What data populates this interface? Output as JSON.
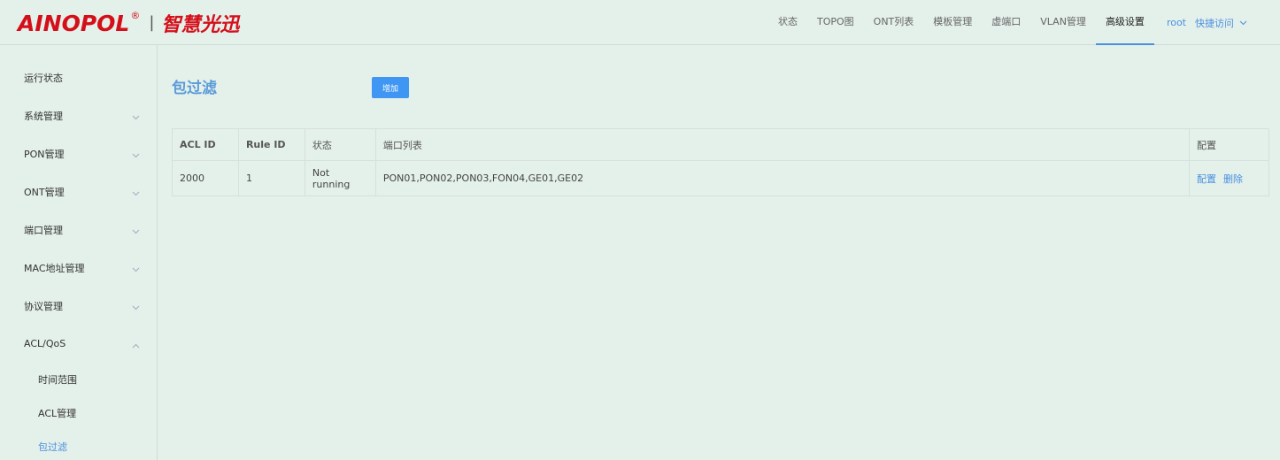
{
  "header": {
    "brand": "AINOPOL",
    "reg_mark": "®",
    "separator": "|",
    "brand_cn": "智慧光迅",
    "nav": [
      "状态",
      "TOPO图",
      "ONT列表",
      "模板管理",
      "虚端口",
      "VLAN管理",
      "高级设置"
    ],
    "active_nav": "高级设置",
    "user": "root",
    "quick_access": "快捷访问"
  },
  "sidebar": {
    "items": [
      "运行状态",
      "系统管理",
      "PON管理",
      "ONT管理",
      "端口管理",
      "MAC地址管理",
      "协议管理",
      "ACL/QoS"
    ],
    "sub_items": [
      "时间范围",
      "ACL管理",
      "包过滤"
    ],
    "active_sub": "包过滤"
  },
  "main": {
    "title": "包过滤",
    "add_label": "增加",
    "table": {
      "headers": [
        "ACL ID",
        "Rule ID",
        "状态",
        "端口列表",
        "配置"
      ],
      "rows": [
        {
          "acl_id": "2000",
          "rule_id": "1",
          "status": "Not running",
          "ports": "PON01,PON02,PON03,FON04,GE01,GE02",
          "op_config": "配置",
          "op_delete": "删除"
        }
      ]
    }
  },
  "colors": {
    "background": "#e4f0ea",
    "accent": "#4a90e2",
    "button": "#3f97f3",
    "brand_red": "#d40f1a"
  }
}
